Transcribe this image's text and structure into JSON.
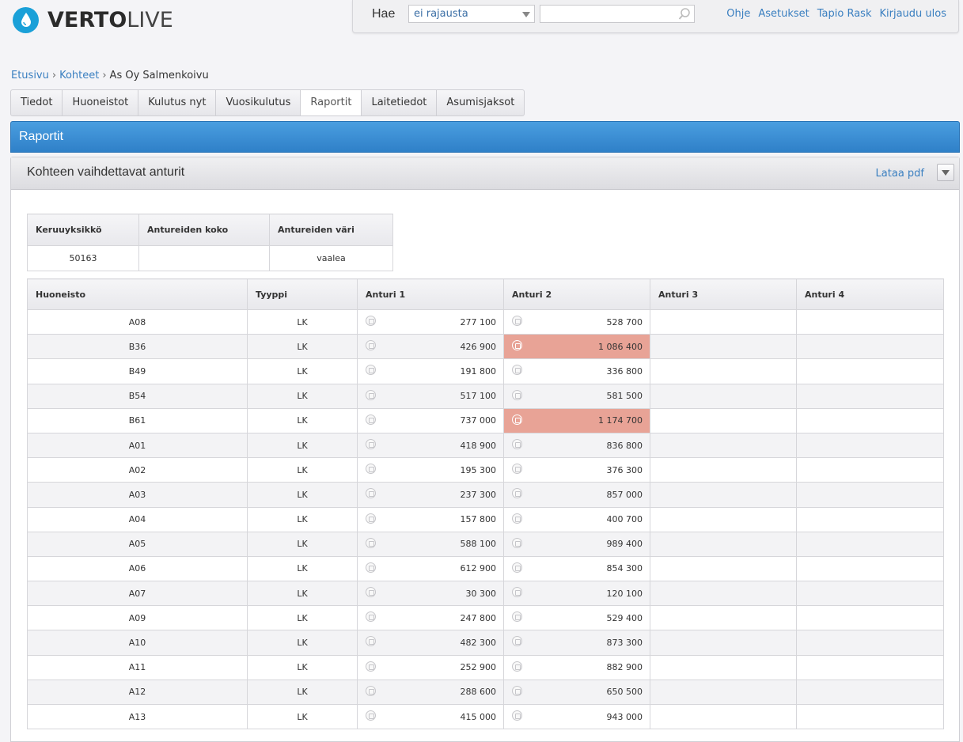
{
  "logo": {
    "brand_bold": "VERTO",
    "brand_light": "LIVE"
  },
  "search": {
    "label": "Hae",
    "filter_value": "ei rajausta",
    "input_value": "",
    "input_placeholder": ""
  },
  "top_links": [
    "Ohje",
    "Asetukset",
    "Tapio Rask",
    "Kirjaudu ulos"
  ],
  "breadcrumb": {
    "items": [
      "Etusivu",
      "Kohteet"
    ],
    "current": "As Oy Salmenkoivu"
  },
  "tabs": [
    {
      "label": "Tiedot",
      "active": false
    },
    {
      "label": "Huoneistot",
      "active": false
    },
    {
      "label": "Kulutus nyt",
      "active": false
    },
    {
      "label": "Vuosikulutus",
      "active": false
    },
    {
      "label": "Raportit",
      "active": true
    },
    {
      "label": "Laitetiedot",
      "active": false
    },
    {
      "label": "Asumisjaksot",
      "active": false
    }
  ],
  "section_title": "Raportit",
  "panel": {
    "title": "Kohteen vaihdettavat anturit",
    "pdf_label": "Lataa pdf"
  },
  "info_table": {
    "headers": [
      "Keruuyksikkö",
      "Antureiden koko",
      "Antureiden väri"
    ],
    "row": [
      "50163",
      "",
      "vaalea"
    ]
  },
  "colors": {
    "highlight": "#e8a396",
    "link": "#3a7fc0",
    "header_blue": "#2f80c8"
  },
  "main_table": {
    "headers": [
      "Huoneisto",
      "Tyyppi",
      "Anturi 1",
      "Anturi 2",
      "Anturi 3",
      "Anturi 4"
    ],
    "rows": [
      {
        "huoneisto": "A08",
        "tyyppi": "LK",
        "a1": "277 100",
        "a2": "528 700",
        "a2_highlight": false
      },
      {
        "huoneisto": "B36",
        "tyyppi": "LK",
        "a1": "426 900",
        "a2": "1 086 400",
        "a2_highlight": true
      },
      {
        "huoneisto": "B49",
        "tyyppi": "LK",
        "a1": "191 800",
        "a2": "336 800",
        "a2_highlight": false
      },
      {
        "huoneisto": "B54",
        "tyyppi": "LK",
        "a1": "517 100",
        "a2": "581 500",
        "a2_highlight": false
      },
      {
        "huoneisto": "B61",
        "tyyppi": "LK",
        "a1": "737 000",
        "a2": "1 174 700",
        "a2_highlight": true
      },
      {
        "huoneisto": "A01",
        "tyyppi": "LK",
        "a1": "418 900",
        "a2": "836 800",
        "a2_highlight": false
      },
      {
        "huoneisto": "A02",
        "tyyppi": "LK",
        "a1": "195 300",
        "a2": "376 300",
        "a2_highlight": false
      },
      {
        "huoneisto": "A03",
        "tyyppi": "LK",
        "a1": "237 300",
        "a2": "857 000",
        "a2_highlight": false
      },
      {
        "huoneisto": "A04",
        "tyyppi": "LK",
        "a1": "157 800",
        "a2": "400 700",
        "a2_highlight": false
      },
      {
        "huoneisto": "A05",
        "tyyppi": "LK",
        "a1": "588 100",
        "a2": "989 400",
        "a2_highlight": false
      },
      {
        "huoneisto": "A06",
        "tyyppi": "LK",
        "a1": "612 900",
        "a2": "854 300",
        "a2_highlight": false
      },
      {
        "huoneisto": "A07",
        "tyyppi": "LK",
        "a1": "30 300",
        "a2": "120 100",
        "a2_highlight": false
      },
      {
        "huoneisto": "A09",
        "tyyppi": "LK",
        "a1": "247 800",
        "a2": "529 400",
        "a2_highlight": false
      },
      {
        "huoneisto": "A10",
        "tyyppi": "LK",
        "a1": "482 300",
        "a2": "873 300",
        "a2_highlight": false
      },
      {
        "huoneisto": "A11",
        "tyyppi": "LK",
        "a1": "252 900",
        "a2": "882 900",
        "a2_highlight": false
      },
      {
        "huoneisto": "A12",
        "tyyppi": "LK",
        "a1": "288 600",
        "a2": "650 500",
        "a2_highlight": false
      },
      {
        "huoneisto": "A13",
        "tyyppi": "LK",
        "a1": "415 000",
        "a2": "943 000",
        "a2_highlight": false
      }
    ]
  }
}
